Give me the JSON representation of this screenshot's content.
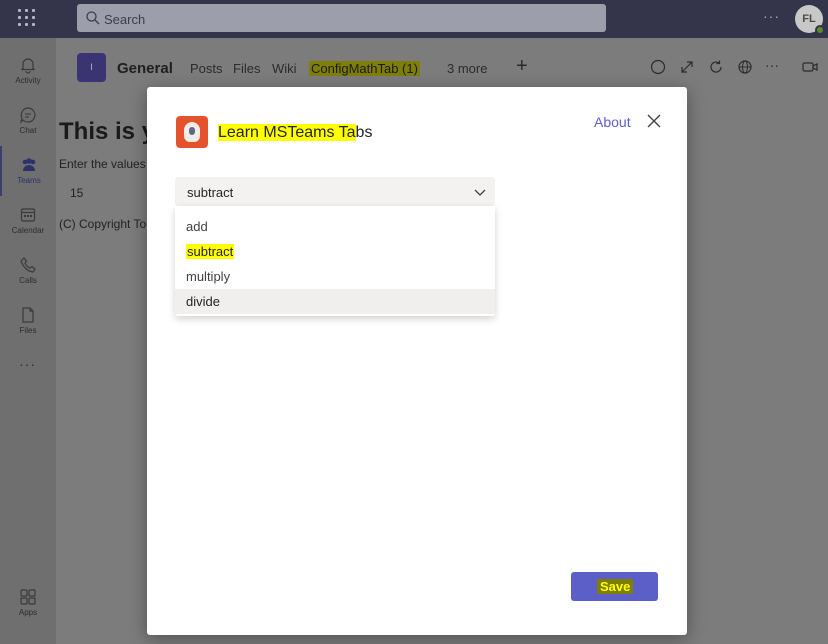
{
  "titlebar": {
    "search_placeholder": "Search",
    "more_label": "···",
    "avatar_initials": "FL"
  },
  "rail": {
    "items": [
      {
        "label": "Activity",
        "icon": "bell-icon"
      },
      {
        "label": "Chat",
        "icon": "chat-icon"
      },
      {
        "label": "Teams",
        "icon": "teams-icon",
        "active": true
      },
      {
        "label": "Calendar",
        "icon": "calendar-icon"
      },
      {
        "label": "Calls",
        "icon": "phone-icon"
      },
      {
        "label": "Files",
        "icon": "file-icon"
      }
    ],
    "more_label": "···",
    "apps_label": "Apps"
  },
  "channel": {
    "badge": "I",
    "name": "General",
    "tabs": [
      "Posts",
      "Files",
      "Wiki",
      "ConfigMathTab (1)",
      "3 more"
    ],
    "highlighted_tab": "ConfigMathTab (1)"
  },
  "background": {
    "heading": "This is y",
    "prompt": "Enter the values",
    "input_value": "15",
    "copyright": "(C) Copyright To"
  },
  "dialog": {
    "title_highlighted": "Learn MSTeams Ta",
    "title_rest": "bs",
    "about_label": "About",
    "dropdown": {
      "selected": "subtract",
      "options": [
        "add",
        "subtract",
        "multiply",
        "divide"
      ],
      "highlighted_option": "subtract",
      "hovered_option": "divide"
    },
    "save_label": "Save"
  },
  "colors": {
    "brand": "#5b5fc7",
    "highlight": "#ffff00",
    "app_icon": "#e4532b",
    "titlebar": "#34354a"
  }
}
